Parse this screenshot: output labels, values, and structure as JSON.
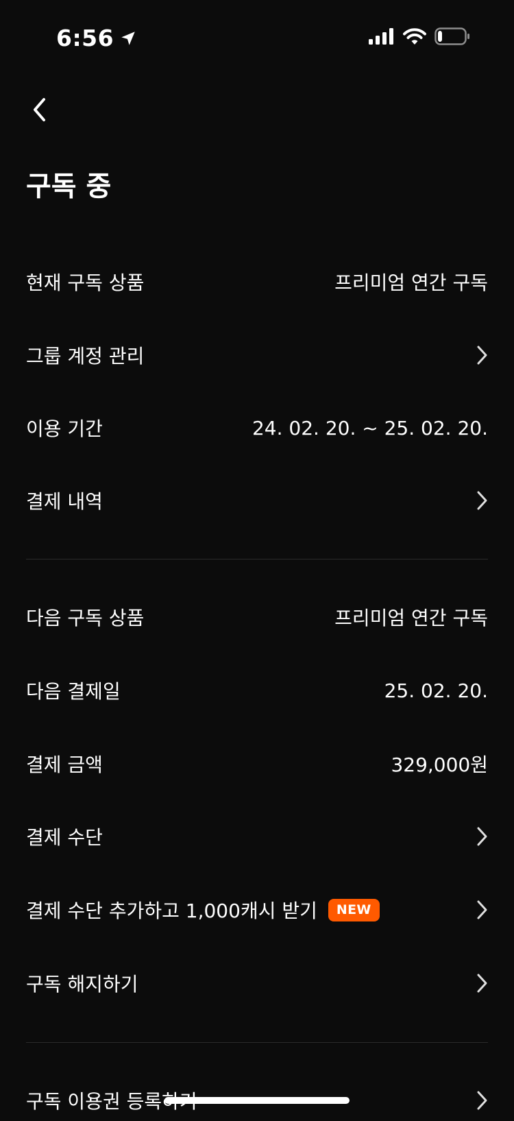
{
  "status_bar": {
    "time": "6:56",
    "icons": [
      "location-arrow-icon",
      "cellular-signal-icon",
      "wifi-icon",
      "battery-icon"
    ],
    "battery_level": 0.15
  },
  "header": {
    "back_icon": "chevron-left-icon",
    "title": "구독 중"
  },
  "current_subscription": {
    "product_label": "현재 구독 상품",
    "product_value": "프리미엄 연간 구독",
    "group_account_label": "그룹 계정 관리",
    "period_label": "이용 기간",
    "period_value": "24. 02. 20. ~ 25. 02. 20.",
    "payment_history_label": "결제 내역"
  },
  "next_subscription": {
    "product_label": "다음 구독 상품",
    "product_value": "프리미엄 연간 구독",
    "next_payment_label": "다음 결제일",
    "next_payment_value": "25. 02. 20.",
    "amount_label": "결제 금액",
    "amount_value": "329,000원",
    "payment_method_label": "결제 수단",
    "add_payment_label": "결제 수단 추가하고 1,000캐시 받기",
    "new_badge": "NEW",
    "cancel_label": "구독 해지하기"
  },
  "voucher": {
    "register_label": "구독 이용권 등록하기"
  },
  "colors": {
    "background": "#0c0c0c",
    "text": "#ffffff",
    "divider": "#2b2b2b",
    "badge": "#ff5a00"
  }
}
